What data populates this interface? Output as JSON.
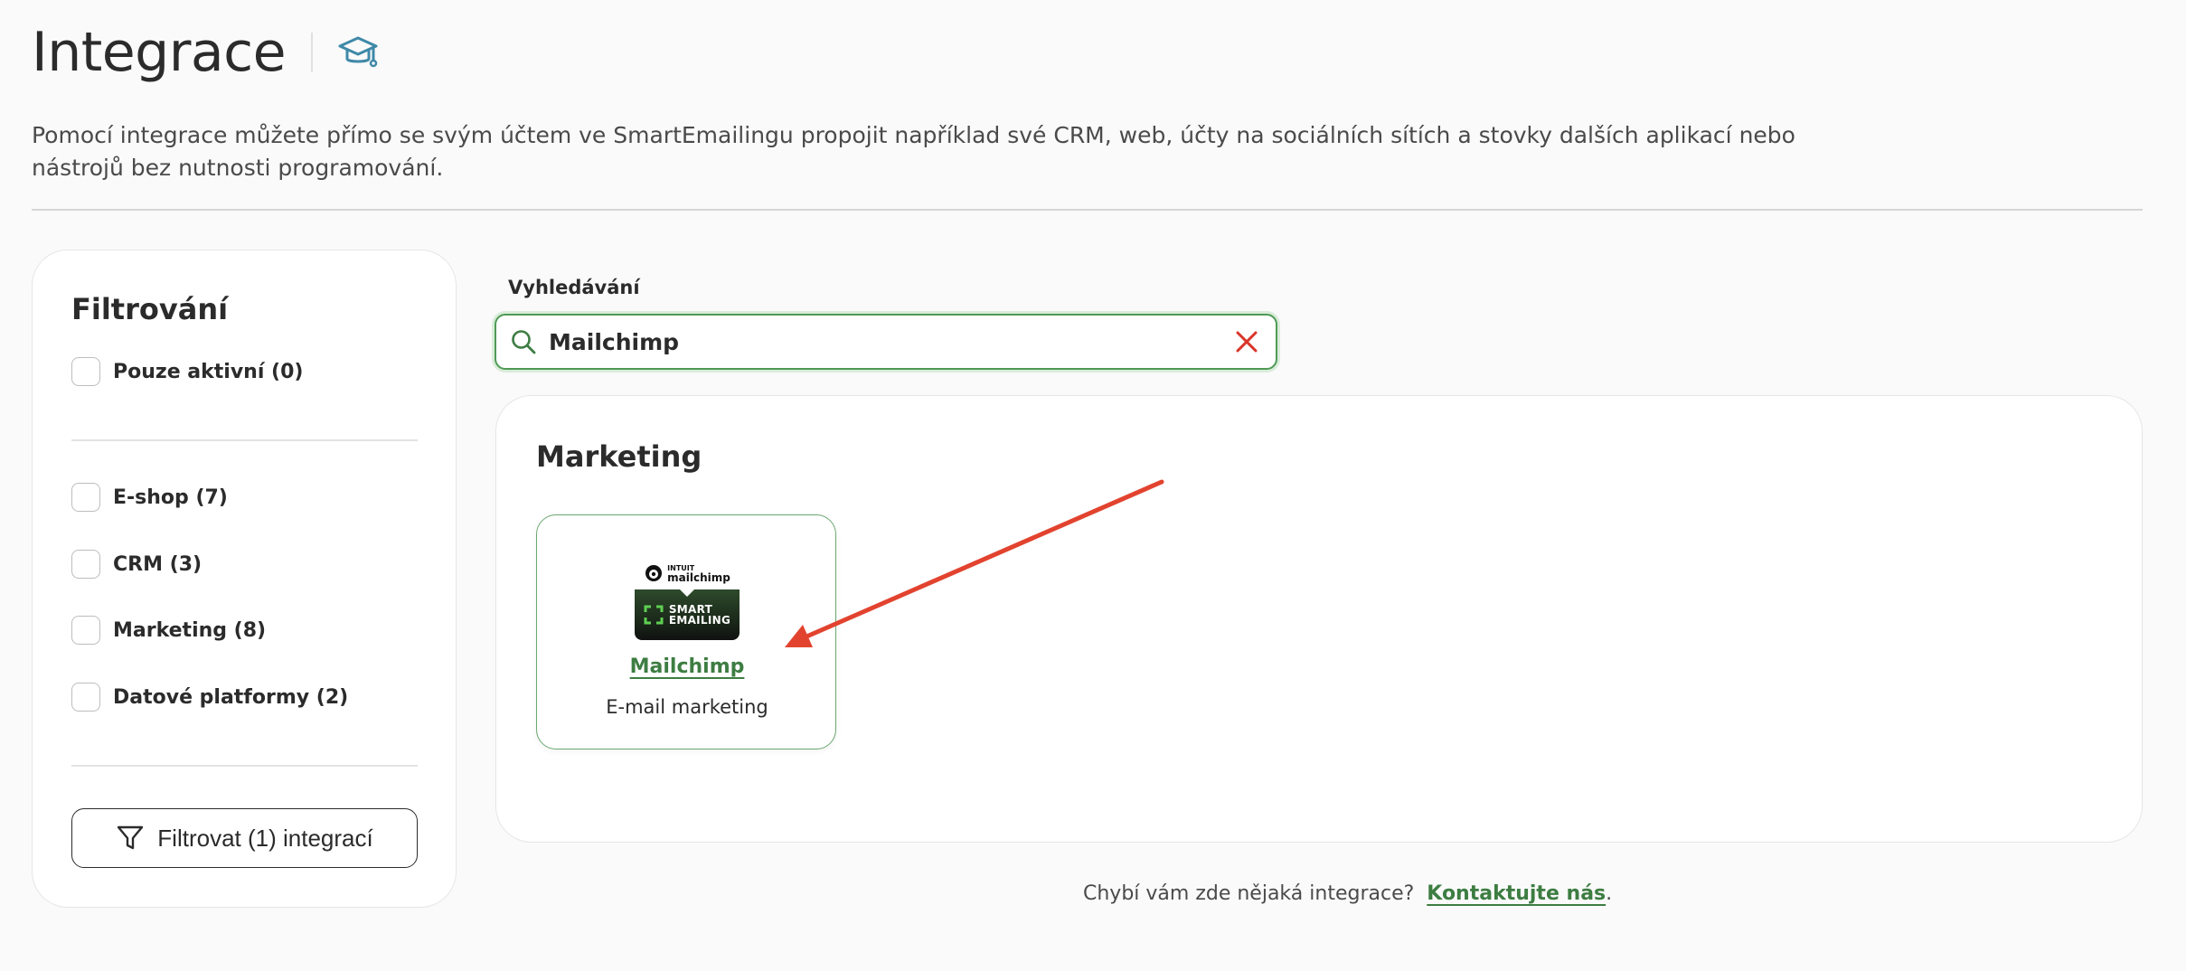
{
  "header": {
    "title": "Integrace",
    "help_icon": "graduation-cap-icon"
  },
  "description": "Pomocí integrace můžete přímo se svým účtem ve SmartEmailingu propojit například své CRM, web, účty na sociálních sítích a stovky dalších aplikací nebo nástrojů bez nutnosti programování.",
  "sidebar": {
    "title": "Filtrování",
    "only_active": "Pouze aktivní (0)",
    "categories": [
      "E-shop (7)",
      "CRM (3)",
      "Marketing (8)",
      "Datové platformy (2)"
    ],
    "filter_button": "Filtrovat (1) integrací"
  },
  "search": {
    "label": "Vyhledávání",
    "value": "Mailchimp"
  },
  "results": {
    "category": "Marketing",
    "card": {
      "name": "Mailchimp",
      "description": "E-mail marketing",
      "logo_top_small": "INTUIT",
      "logo_top": "mailchimp",
      "logo_bottom_line1": "SMART",
      "logo_bottom_line2": "EMAILING"
    }
  },
  "footer": {
    "text": "Chybí vám zde nějaká integrace?",
    "link": "Kontaktujte nás",
    "suffix": "."
  },
  "colors": {
    "accent_green": "#3d7d42",
    "clear_red": "#d9352a",
    "annotation_arrow": "#e2432f"
  }
}
